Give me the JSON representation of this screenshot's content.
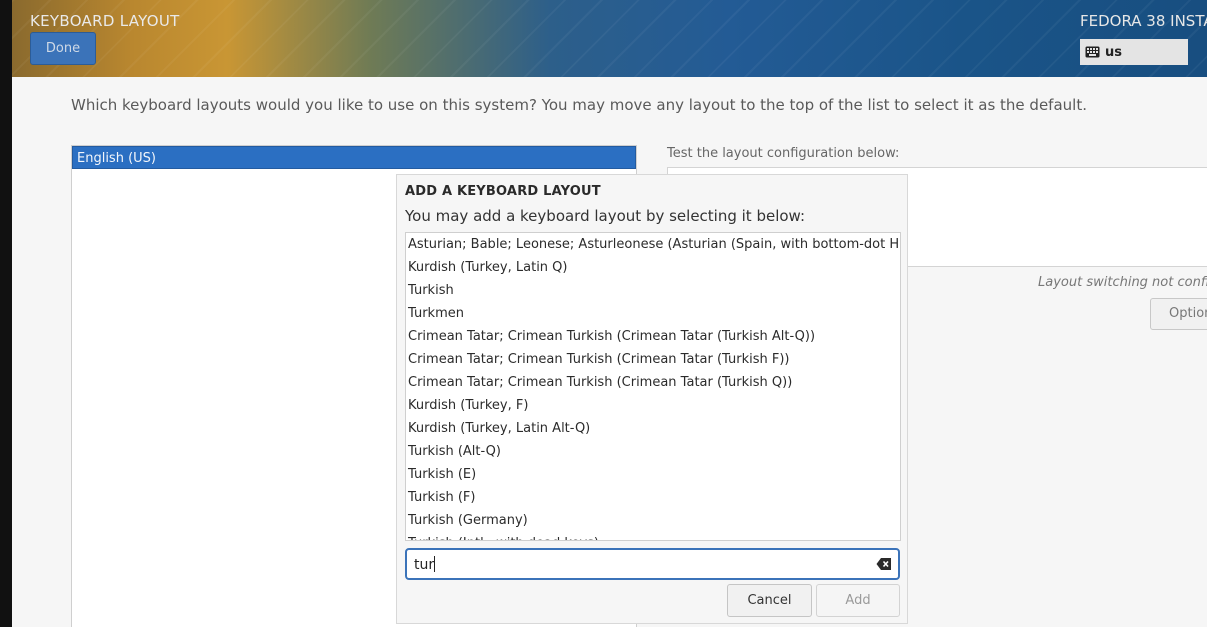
{
  "header": {
    "title": "KEYBOARD LAYOUT",
    "done_label": "Done",
    "installer_title": "FEDORA 38 INSTA",
    "keyboard_indicator": "us"
  },
  "main": {
    "question": "Which keyboard layouts would you like to use on this system?  You may move any layout to the top of the list to select it as the default.",
    "layouts": [
      "English (US)"
    ],
    "test_label": "Test the layout configuration below:",
    "switching_note": "Layout switching not configu",
    "options_label": "Option"
  },
  "dialog": {
    "title": "ADD A KEYBOARD LAYOUT",
    "subtitle": "You may add a keyboard layout by selecting it below:",
    "items": [
      "Asturian; Bable; Leonese; Asturleonese (Asturian (Spain, with bottom-dot H and L))",
      "Kurdish (Turkey, Latin Q)",
      "Turkish",
      "Turkmen",
      "Crimean Tatar; Crimean Turkish (Crimean Tatar (Turkish Alt-Q))",
      "Crimean Tatar; Crimean Turkish (Crimean Tatar (Turkish F))",
      "Crimean Tatar; Crimean Turkish (Crimean Tatar (Turkish Q))",
      "Kurdish (Turkey, F)",
      "Kurdish (Turkey, Latin Alt-Q)",
      "Turkish (Alt-Q)",
      "Turkish (E)",
      "Turkish (F)",
      "Turkish (Germany)",
      "Turkish (Intl., with dead keys)"
    ],
    "search_value": "tur",
    "cancel_label": "Cancel",
    "add_label": "Add"
  },
  "colors": {
    "accent": "#3b73b9",
    "selection": "#2b6fc2"
  }
}
